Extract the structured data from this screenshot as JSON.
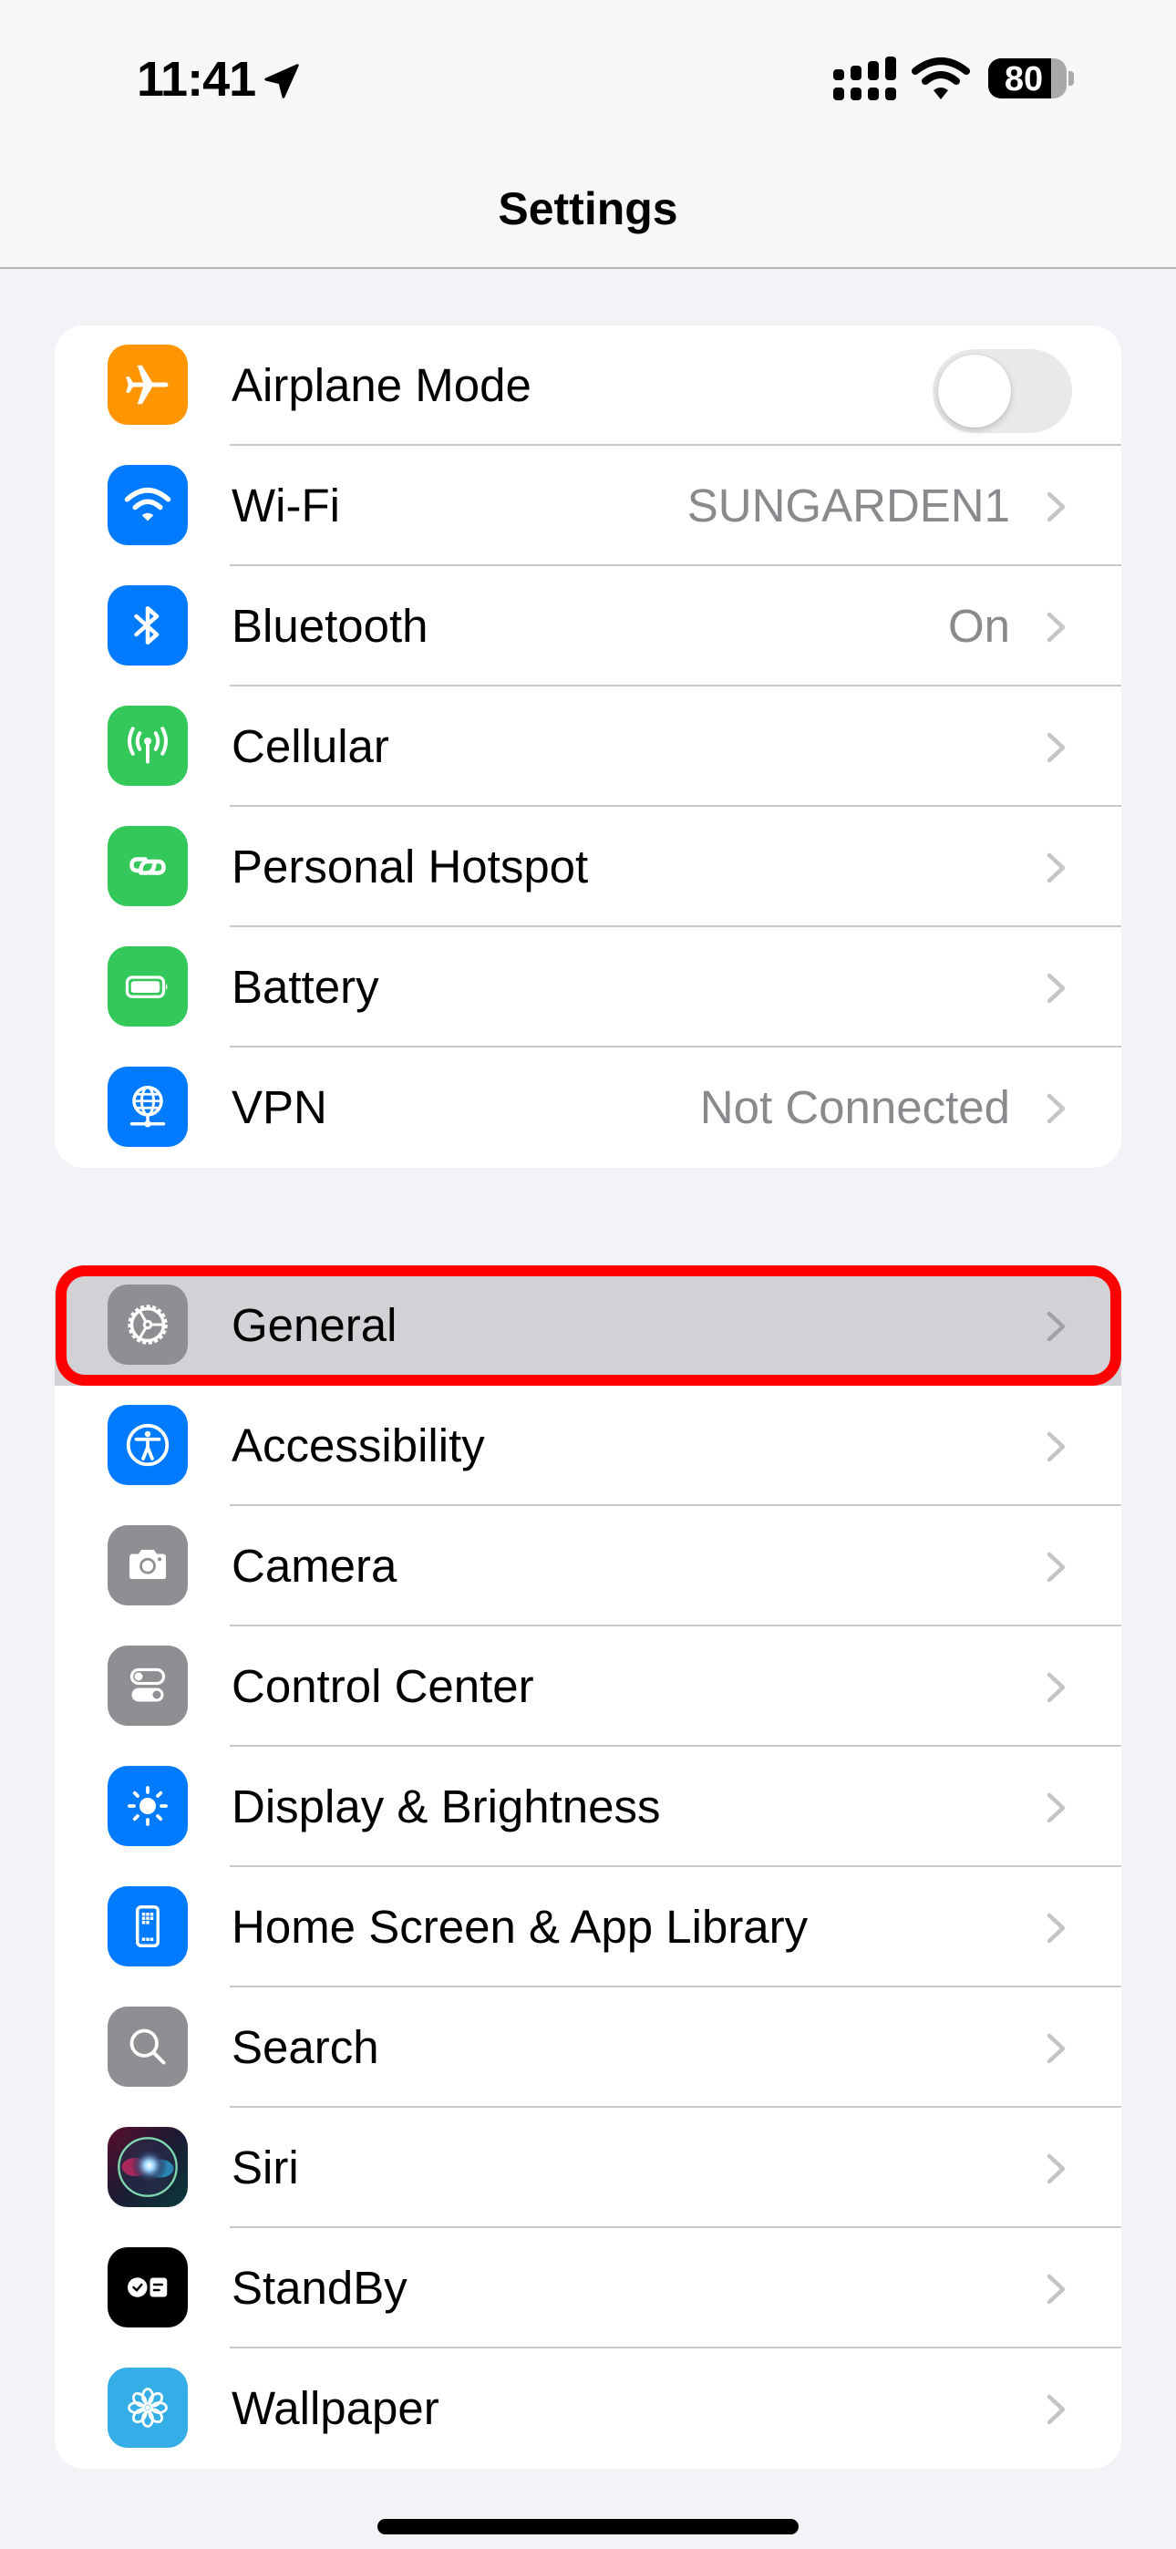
{
  "status_bar": {
    "time": "11:41",
    "location_icon": "location-arrow-icon",
    "signal_icon": "cellular-signal-icon",
    "wifi_icon": "wifi-icon",
    "battery_percent": 80,
    "battery_label": "80"
  },
  "nav": {
    "title": "Settings"
  },
  "groups": [
    {
      "items": [
        {
          "label": "Airplane Mode",
          "icon": "airplane-icon",
          "icon_color": "#ff9500",
          "type": "toggle",
          "toggle_on": false
        },
        {
          "label": "Wi-Fi",
          "icon": "wifi-icon",
          "icon_color": "#007aff",
          "value": "SUNGARDEN1"
        },
        {
          "label": "Bluetooth",
          "icon": "bluetooth-icon",
          "icon_color": "#007aff",
          "value": "On"
        },
        {
          "label": "Cellular",
          "icon": "antenna-icon",
          "icon_color": "#34c759"
        },
        {
          "label": "Personal Hotspot",
          "icon": "link-icon",
          "icon_color": "#34c759"
        },
        {
          "label": "Battery",
          "icon": "battery-icon",
          "icon_color": "#34c759"
        },
        {
          "label": "VPN",
          "icon": "globe-network-icon",
          "icon_color": "#007aff",
          "value": "Not Connected"
        }
      ]
    },
    {
      "items": [
        {
          "label": "General",
          "icon": "gear-icon",
          "icon_color": "#8e8e93",
          "highlighted": true
        },
        {
          "label": "Accessibility",
          "icon": "accessibility-icon",
          "icon_color": "#007aff"
        },
        {
          "label": "Camera",
          "icon": "camera-icon",
          "icon_color": "#8e8e93"
        },
        {
          "label": "Control Center",
          "icon": "switches-icon",
          "icon_color": "#8e8e93"
        },
        {
          "label": "Display & Brightness",
          "icon": "sun-icon",
          "icon_color": "#007aff"
        },
        {
          "label": "Home Screen & App Library",
          "icon": "phone-grid-icon",
          "icon_color": "#007aff"
        },
        {
          "label": "Search",
          "icon": "magnifier-icon",
          "icon_color": "#8e8e93"
        },
        {
          "label": "Siri",
          "icon": "siri-icon",
          "icon_color": "#1a1a2e"
        },
        {
          "label": "StandBy",
          "icon": "standby-icon",
          "icon_color": "#000000"
        },
        {
          "label": "Wallpaper",
          "icon": "flower-icon",
          "icon_color": "#35aee8"
        }
      ]
    }
  ],
  "highlight_color": "#ff0000"
}
